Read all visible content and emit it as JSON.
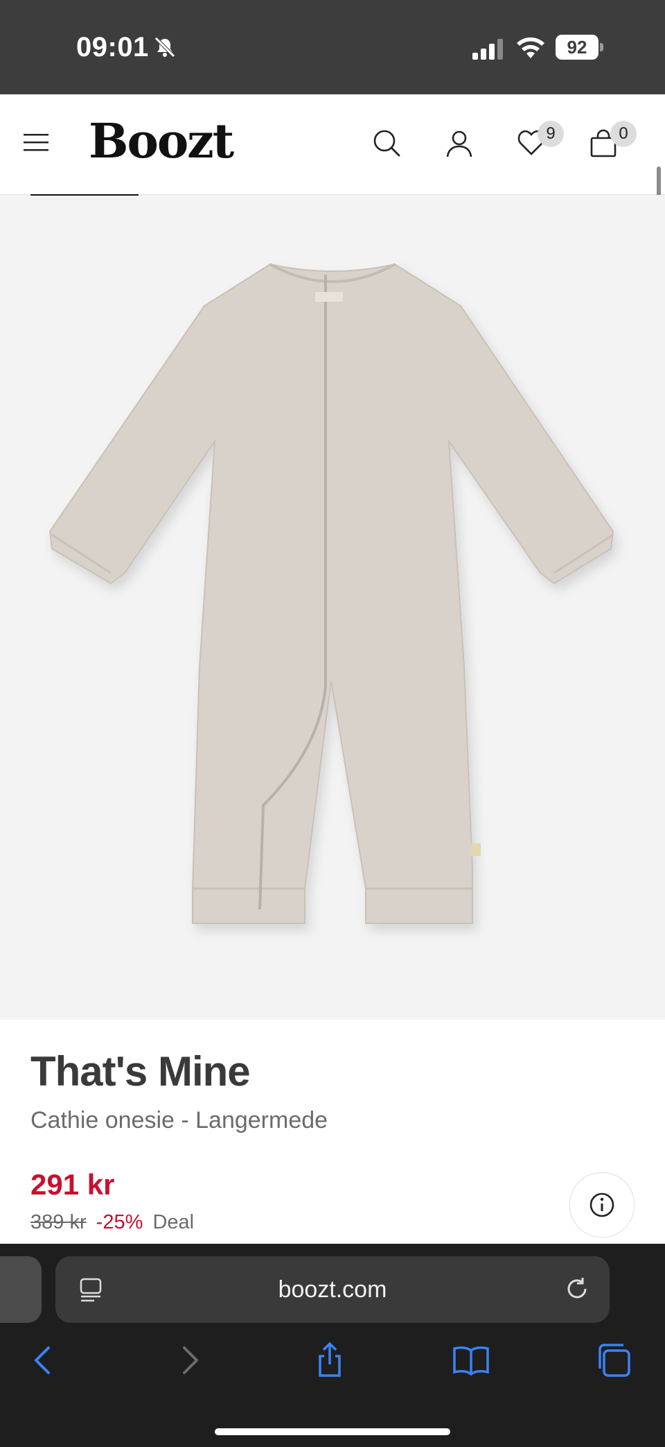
{
  "status": {
    "time": "09:01",
    "battery": "92"
  },
  "header": {
    "logo": "Boozt",
    "wishlist_count": "9",
    "cart_count": "0"
  },
  "product": {
    "brand": "That's Mine",
    "name": "Cathie onesie - Langermede",
    "price": "291 kr",
    "old_price": "389 kr",
    "discount": "-25%",
    "deal_label": "Deal"
  },
  "browser": {
    "url": "boozt.com"
  },
  "icons": {
    "menu": "hamburger-menu-icon",
    "search": "search-icon",
    "account": "user-icon",
    "wishlist": "heart-icon",
    "cart": "shopping-bag-icon",
    "info": "info-icon",
    "back": "chevron-left-icon",
    "forward": "chevron-right-icon",
    "share": "share-icon",
    "bookmarks": "book-icon",
    "tabs": "tabs-icon"
  },
  "colors": {
    "accent_red": "#c8102e",
    "browser_blue": "#3b82f6",
    "image_bg": "#f3f3f3",
    "garment": "#d9d2ca"
  }
}
